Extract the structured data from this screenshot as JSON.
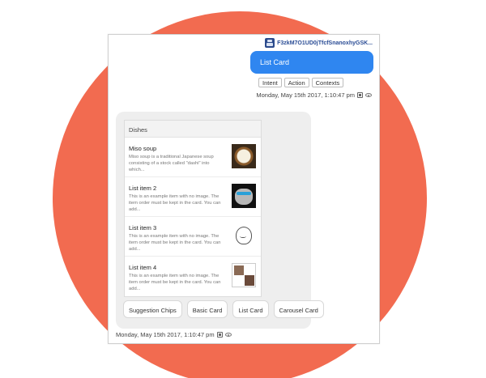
{
  "user": {
    "id_label": "F3zkM7O1UD0jTfcfSnanoxhyGSK...",
    "message": "List Card"
  },
  "top_chips": [
    "Intent",
    "Action",
    "Contexts"
  ],
  "timestamps": {
    "user": "Monday, May 15th 2017, 1:10:47 pm",
    "bot": "Monday, May 15th 2017, 1:10:47 pm"
  },
  "list_card": {
    "title": "Dishes",
    "items": [
      {
        "title": "Miso soup",
        "description": "Miso soup is a traditional Japanese soup consisting of a stock called \"dashi\" into which...",
        "image": "miso-soup-image"
      },
      {
        "title": "List item 2",
        "description": "This is an example item with no image. The item order must be kept in the card. You can add...",
        "image": "grumpy-cat-image"
      },
      {
        "title": "List item 3",
        "description": "This is an example item with no image. The item order must be kept in the card. You can add...",
        "image": "sketch-face-image"
      },
      {
        "title": "List item 4",
        "description": "This is an example item with no image. The item order must be kept in the card. You can add...",
        "image": "meme-image"
      }
    ]
  },
  "suggestion_chips": [
    "Suggestion Chips",
    "Basic Card",
    "List Card",
    "Carousel Card"
  ],
  "colors": {
    "background_circle": "#f26b50",
    "user_bubble": "#2f86f0",
    "bot_card": "#eeeeee"
  }
}
